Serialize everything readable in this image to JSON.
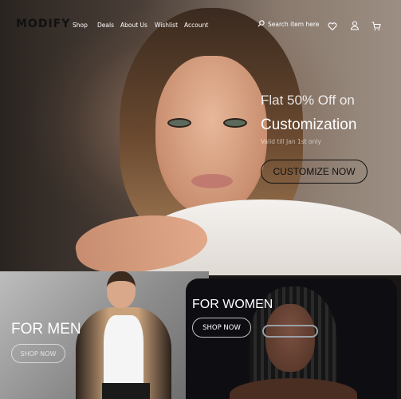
{
  "brand": {
    "logo": "MODIFY"
  },
  "nav": {
    "items": [
      {
        "label": "Shop"
      },
      {
        "label": "Deals"
      },
      {
        "label": "About Us"
      },
      {
        "label": "Wishlist"
      },
      {
        "label": "Account"
      }
    ],
    "search_label": "Search item here",
    "icons": [
      "search-icon",
      "heart-icon",
      "user-icon",
      "cart-icon"
    ]
  },
  "hero": {
    "headline": "Flat 50% Off on",
    "headline2": "Customization",
    "subtext": "Valid till Jan 1st only",
    "cta_label": "CUSTOMIZE NOW"
  },
  "categories": [
    {
      "title": "FOR MEN",
      "button": "SHOP NOW"
    },
    {
      "title": "FOR WOMEN",
      "button": "SHOP NOW"
    }
  ],
  "colors": {
    "text_light": "#ffffff",
    "text_dark": "#111111",
    "women_card_bg": "#0d0d12"
  }
}
